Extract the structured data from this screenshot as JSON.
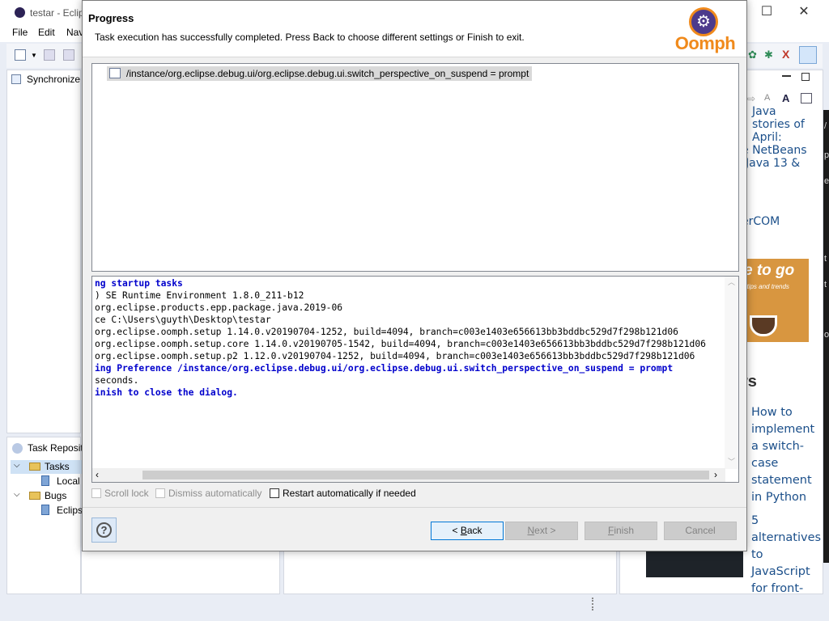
{
  "background": {
    "window_title": "testar - Eclip",
    "menu": [
      "File",
      "Edit",
      "Nav"
    ],
    "left_view_title": "Synchronize",
    "task_view": {
      "title": "Task Reposito",
      "items": [
        {
          "label": "Tasks",
          "child": "Local"
        },
        {
          "label": "Bugs",
          "child": "Eclips"
        }
      ]
    },
    "news": {
      "item1": [
        "Java",
        "stories of",
        "April:",
        "e NetBeans",
        "Java 13 &"
      ],
      "item2": "erCOM",
      "banner_word": "e to go",
      "banner_sub": ", tips and trends",
      "heading": "rs",
      "article1": [
        "How to",
        "implement",
        "a switch-",
        "case",
        "statement",
        "in Python"
      ],
      "article2": [
        "5",
        "alternatives",
        "to",
        "JavaScript",
        "for front-"
      ]
    },
    "strip_chars": [
      "/",
      "p",
      "e",
      "t",
      "t",
      "o"
    ]
  },
  "dialog": {
    "title": "Progress",
    "message": "Task execution has successfully completed.  Press Back to choose different settings or Finish to exit.",
    "logo_text": "Oomph",
    "task_row": "/instance/org.eclipse.debug.ui/org.eclipse.debug.ui.switch_perspective_on_suspend = prompt",
    "log": [
      {
        "text": "ng startup tasks",
        "style": "blue"
      },
      {
        "text": ") SE Runtime Environment 1.8.0_211-b12",
        "style": "plain"
      },
      {
        "text": " org.eclipse.products.epp.package.java.2019-06",
        "style": "plain"
      },
      {
        "text": "ce C:\\Users\\guyth\\Desktop\\testar",
        "style": "plain"
      },
      {
        "text": "org.eclipse.oomph.setup 1.14.0.v20190704-1252, build=4094, branch=c003e1403e656613bb3bddbc529d7f298b121d06",
        "style": "plain"
      },
      {
        "text": "org.eclipse.oomph.setup.core 1.14.0.v20190705-1542, build=4094, branch=c003e1403e656613bb3bddbc529d7f298b121d06",
        "style": "plain"
      },
      {
        "text": "org.eclipse.oomph.setup.p2 1.12.0.v20190704-1252, build=4094, branch=c003e1403e656613bb3bddbc529d7f298b121d06",
        "style": "plain"
      },
      {
        "text": "ing Preference /instance/org.eclipse.debug.ui/org.eclipse.debug.ui.switch_perspective_on_suspend = prompt",
        "style": "blue"
      },
      {
        "text": "seconds.",
        "style": "plain"
      },
      {
        "text": "inish to close the dialog.",
        "style": "blue"
      }
    ],
    "checkboxes": {
      "scroll_lock": "Scroll lock",
      "dismiss": "Dismiss automatically",
      "restart": "Restart automatically if needed"
    },
    "buttons": {
      "back_mnemonic": "B",
      "back_rest": "ack",
      "next_mnemonic": "N",
      "next_rest": "ext >",
      "finish_mnemonic": "F",
      "finish_rest": "inish",
      "cancel": "Cancel"
    }
  }
}
